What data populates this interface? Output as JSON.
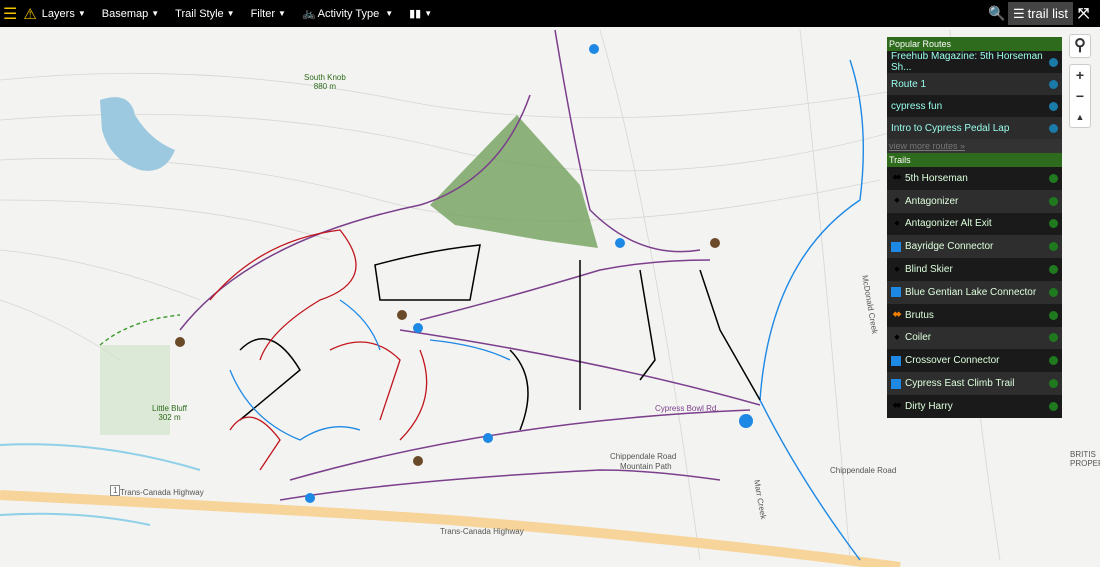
{
  "toolbar": {
    "layers": "Layers",
    "basemap": "Basemap",
    "trail_style": "Trail Style",
    "filter": "Filter",
    "activity_type": "Activity Type",
    "trail_list": "trail list"
  },
  "popular_routes": {
    "title": "Popular Routes",
    "items": [
      "Freehub Magazine: 5th Horseman Sh...",
      "Route 1",
      "cypress fun",
      "Intro to Cypress Pedal Lap"
    ],
    "view_more": "view more routes »"
  },
  "trails": {
    "title": "Trails",
    "items": [
      {
        "name": "5th Horseman",
        "difficulty": "double-black"
      },
      {
        "name": "Antagonizer",
        "difficulty": "black"
      },
      {
        "name": "Antagonizer Alt Exit",
        "difficulty": "black"
      },
      {
        "name": "Bayridge Connector",
        "difficulty": "blue"
      },
      {
        "name": "Blind Skier",
        "difficulty": "black"
      },
      {
        "name": "Blue Gentian Lake Connector",
        "difficulty": "blue"
      },
      {
        "name": "Brutus",
        "difficulty": "pro"
      },
      {
        "name": "Coiler",
        "difficulty": "black"
      },
      {
        "name": "Crossover Connector",
        "difficulty": "blue"
      },
      {
        "name": "Cypress East Climb Trail",
        "difficulty": "blue"
      },
      {
        "name": "Dirty Harry",
        "difficulty": "double-black"
      }
    ]
  },
  "map": {
    "south_knob": "South Knob",
    "south_knob_elev": "880 m",
    "little_bluff": "Little Bluff",
    "little_bluff_elev": "302 m",
    "highway": "Trans-Canada Highway",
    "highway_shield": "1",
    "cypress_bowl": "Cypress Bowl Rd.",
    "chippendale": "Chippendale Road",
    "mountain_path": "Mountain Path",
    "mcdonald_creek": "McDonald Creek",
    "marr_creek": "Marr Creek",
    "british": "BRITIS PROPER"
  },
  "colors": {
    "accent_green": "#2e6b1c",
    "blue": "#1e88e5",
    "black": "#000000",
    "red": "#c0141c",
    "purple": "#7b3f8c"
  }
}
